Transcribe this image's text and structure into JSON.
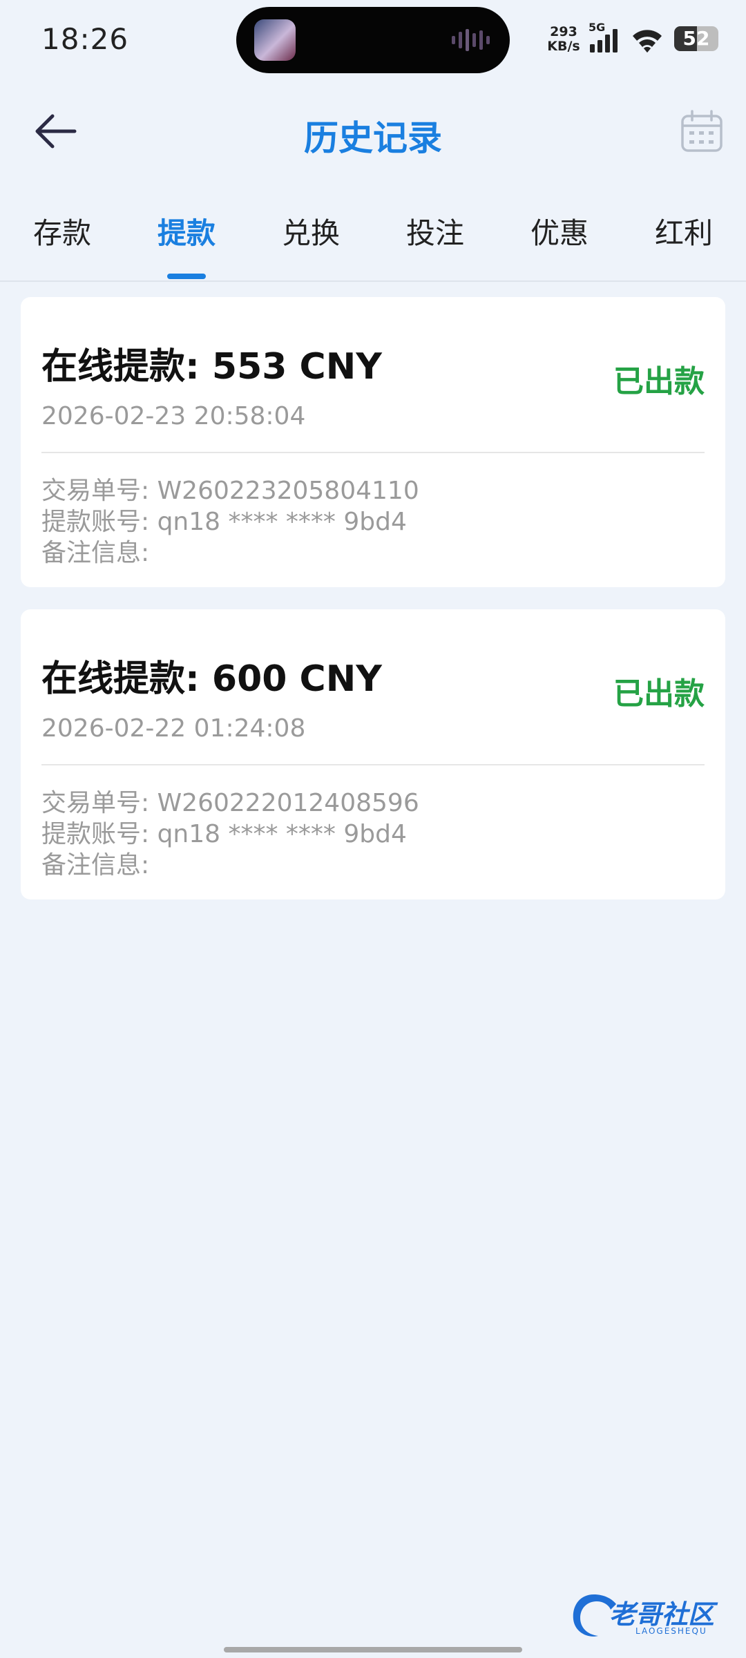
{
  "status_bar": {
    "time": "18:26",
    "net_speed_value": "293",
    "net_speed_unit": "KB/s",
    "network_type": "5G",
    "battery_level": "52"
  },
  "header": {
    "title": "历史记录"
  },
  "tabs": [
    {
      "label": "存款",
      "active": false
    },
    {
      "label": "提款",
      "active": true
    },
    {
      "label": "兑换",
      "active": false
    },
    {
      "label": "投注",
      "active": false
    },
    {
      "label": "优惠",
      "active": false
    },
    {
      "label": "红利",
      "active": false
    }
  ],
  "records": [
    {
      "title": "在线提款: 553 CNY",
      "status": "已出款",
      "datetime": "2026-02-23 20:58:04",
      "transaction_no": "交易单号: W260223205804110",
      "account": "提款账号: qn18 **** **** 9bd4",
      "remark": "备注信息:"
    },
    {
      "title": "在线提款: 600 CNY",
      "status": "已出款",
      "datetime": "2026-02-22 01:24:08",
      "transaction_no": "交易单号: W260222012408596",
      "account": "提款账号: qn18 **** **** 9bd4",
      "remark": "备注信息:"
    }
  ],
  "watermark": {
    "text": "老哥社区",
    "subtext": "LAOGESHEQU"
  },
  "colors": {
    "accent": "#1A7FE0",
    "status_success": "#25A245",
    "background": "#EEF3FA"
  },
  "icons": {
    "back": "arrow-left-icon",
    "calendar": "calendar-icon"
  }
}
